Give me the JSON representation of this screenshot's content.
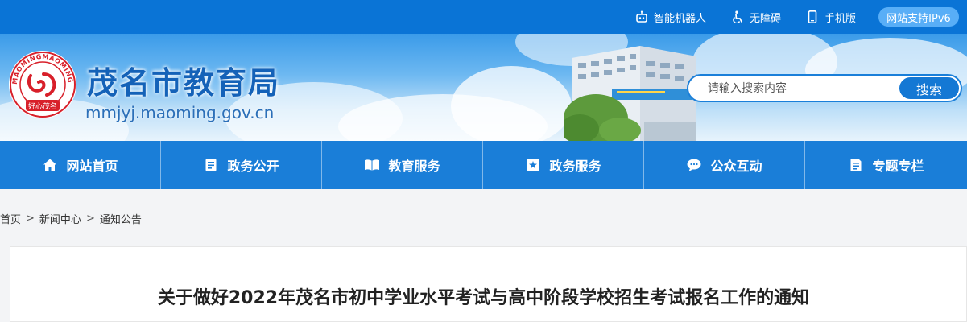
{
  "topbar": {
    "items": [
      {
        "label": "智能机器人",
        "icon": "robot-icon"
      },
      {
        "label": "无障碍",
        "icon": "accessibility-icon"
      },
      {
        "label": "手机版",
        "icon": "mobile-icon"
      }
    ],
    "ipv6_label": "网站支持IPv6"
  },
  "header": {
    "title": "茂名市教育局",
    "domain": "mmjyj.maoming.gov.cn",
    "logo_ring_text": "MAOMINGMAOMING",
    "logo_caption": "好心茂名"
  },
  "search": {
    "placeholder": "请输入搜索内容",
    "button_label": "搜索"
  },
  "nav": {
    "items": [
      {
        "label": "网站首页",
        "icon": "home-icon"
      },
      {
        "label": "政务公开",
        "icon": "document-icon"
      },
      {
        "label": "教育服务",
        "icon": "book-icon"
      },
      {
        "label": "政务服务",
        "icon": "star-icon"
      },
      {
        "label": "公众互动",
        "icon": "chat-icon"
      },
      {
        "label": "专题专栏",
        "icon": "list-icon"
      }
    ]
  },
  "breadcrumb": {
    "items": [
      "首页",
      "新闻中心",
      "通知公告"
    ],
    "separator": ">"
  },
  "article": {
    "title": "关于做好2022年茂名市初中学业水平考试与高中阶段学校招生考试报名工作的通知"
  },
  "colors": {
    "topbar": "#0a74d6",
    "nav": "#1a7ed8",
    "title_blue": "#1462b8",
    "search_button": "#1478d4"
  }
}
